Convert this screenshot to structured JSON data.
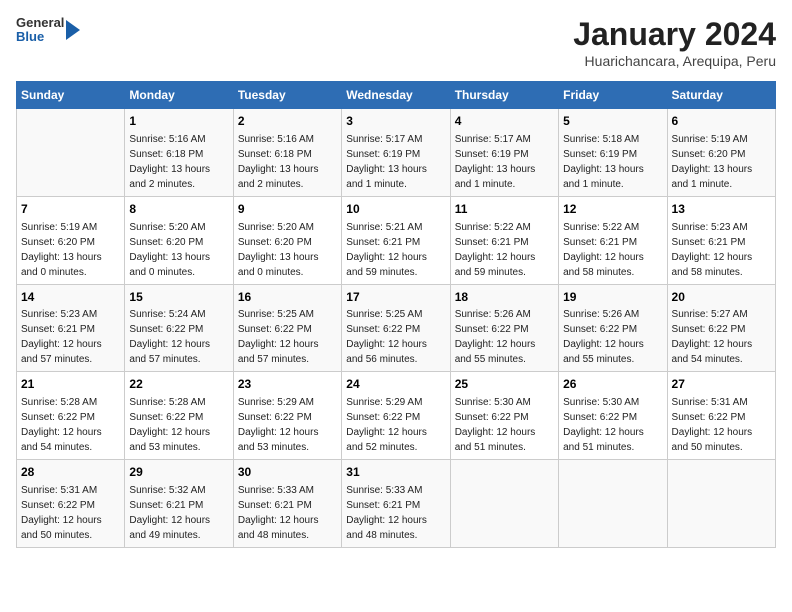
{
  "logo": {
    "general": "General",
    "blue": "Blue"
  },
  "title": "January 2024",
  "subtitle": "Huarichancara, Arequipa, Peru",
  "headers": [
    "Sunday",
    "Monday",
    "Tuesday",
    "Wednesday",
    "Thursday",
    "Friday",
    "Saturday"
  ],
  "weeks": [
    [
      {
        "day": "",
        "sunrise": "",
        "sunset": "",
        "daylight": ""
      },
      {
        "day": "1",
        "sunrise": "Sunrise: 5:16 AM",
        "sunset": "Sunset: 6:18 PM",
        "daylight": "Daylight: 13 hours and 2 minutes."
      },
      {
        "day": "2",
        "sunrise": "Sunrise: 5:16 AM",
        "sunset": "Sunset: 6:18 PM",
        "daylight": "Daylight: 13 hours and 2 minutes."
      },
      {
        "day": "3",
        "sunrise": "Sunrise: 5:17 AM",
        "sunset": "Sunset: 6:19 PM",
        "daylight": "Daylight: 13 hours and 1 minute."
      },
      {
        "day": "4",
        "sunrise": "Sunrise: 5:17 AM",
        "sunset": "Sunset: 6:19 PM",
        "daylight": "Daylight: 13 hours and 1 minute."
      },
      {
        "day": "5",
        "sunrise": "Sunrise: 5:18 AM",
        "sunset": "Sunset: 6:19 PM",
        "daylight": "Daylight: 13 hours and 1 minute."
      },
      {
        "day": "6",
        "sunrise": "Sunrise: 5:19 AM",
        "sunset": "Sunset: 6:20 PM",
        "daylight": "Daylight: 13 hours and 1 minute."
      }
    ],
    [
      {
        "day": "7",
        "sunrise": "Sunrise: 5:19 AM",
        "sunset": "Sunset: 6:20 PM",
        "daylight": "Daylight: 13 hours and 0 minutes."
      },
      {
        "day": "8",
        "sunrise": "Sunrise: 5:20 AM",
        "sunset": "Sunset: 6:20 PM",
        "daylight": "Daylight: 13 hours and 0 minutes."
      },
      {
        "day": "9",
        "sunrise": "Sunrise: 5:20 AM",
        "sunset": "Sunset: 6:20 PM",
        "daylight": "Daylight: 13 hours and 0 minutes."
      },
      {
        "day": "10",
        "sunrise": "Sunrise: 5:21 AM",
        "sunset": "Sunset: 6:21 PM",
        "daylight": "Daylight: 12 hours and 59 minutes."
      },
      {
        "day": "11",
        "sunrise": "Sunrise: 5:22 AM",
        "sunset": "Sunset: 6:21 PM",
        "daylight": "Daylight: 12 hours and 59 minutes."
      },
      {
        "day": "12",
        "sunrise": "Sunrise: 5:22 AM",
        "sunset": "Sunset: 6:21 PM",
        "daylight": "Daylight: 12 hours and 58 minutes."
      },
      {
        "day": "13",
        "sunrise": "Sunrise: 5:23 AM",
        "sunset": "Sunset: 6:21 PM",
        "daylight": "Daylight: 12 hours and 58 minutes."
      }
    ],
    [
      {
        "day": "14",
        "sunrise": "Sunrise: 5:23 AM",
        "sunset": "Sunset: 6:21 PM",
        "daylight": "Daylight: 12 hours and 57 minutes."
      },
      {
        "day": "15",
        "sunrise": "Sunrise: 5:24 AM",
        "sunset": "Sunset: 6:22 PM",
        "daylight": "Daylight: 12 hours and 57 minutes."
      },
      {
        "day": "16",
        "sunrise": "Sunrise: 5:25 AM",
        "sunset": "Sunset: 6:22 PM",
        "daylight": "Daylight: 12 hours and 57 minutes."
      },
      {
        "day": "17",
        "sunrise": "Sunrise: 5:25 AM",
        "sunset": "Sunset: 6:22 PM",
        "daylight": "Daylight: 12 hours and 56 minutes."
      },
      {
        "day": "18",
        "sunrise": "Sunrise: 5:26 AM",
        "sunset": "Sunset: 6:22 PM",
        "daylight": "Daylight: 12 hours and 55 minutes."
      },
      {
        "day": "19",
        "sunrise": "Sunrise: 5:26 AM",
        "sunset": "Sunset: 6:22 PM",
        "daylight": "Daylight: 12 hours and 55 minutes."
      },
      {
        "day": "20",
        "sunrise": "Sunrise: 5:27 AM",
        "sunset": "Sunset: 6:22 PM",
        "daylight": "Daylight: 12 hours and 54 minutes."
      }
    ],
    [
      {
        "day": "21",
        "sunrise": "Sunrise: 5:28 AM",
        "sunset": "Sunset: 6:22 PM",
        "daylight": "Daylight: 12 hours and 54 minutes."
      },
      {
        "day": "22",
        "sunrise": "Sunrise: 5:28 AM",
        "sunset": "Sunset: 6:22 PM",
        "daylight": "Daylight: 12 hours and 53 minutes."
      },
      {
        "day": "23",
        "sunrise": "Sunrise: 5:29 AM",
        "sunset": "Sunset: 6:22 PM",
        "daylight": "Daylight: 12 hours and 53 minutes."
      },
      {
        "day": "24",
        "sunrise": "Sunrise: 5:29 AM",
        "sunset": "Sunset: 6:22 PM",
        "daylight": "Daylight: 12 hours and 52 minutes."
      },
      {
        "day": "25",
        "sunrise": "Sunrise: 5:30 AM",
        "sunset": "Sunset: 6:22 PM",
        "daylight": "Daylight: 12 hours and 51 minutes."
      },
      {
        "day": "26",
        "sunrise": "Sunrise: 5:30 AM",
        "sunset": "Sunset: 6:22 PM",
        "daylight": "Daylight: 12 hours and 51 minutes."
      },
      {
        "day": "27",
        "sunrise": "Sunrise: 5:31 AM",
        "sunset": "Sunset: 6:22 PM",
        "daylight": "Daylight: 12 hours and 50 minutes."
      }
    ],
    [
      {
        "day": "28",
        "sunrise": "Sunrise: 5:31 AM",
        "sunset": "Sunset: 6:22 PM",
        "daylight": "Daylight: 12 hours and 50 minutes."
      },
      {
        "day": "29",
        "sunrise": "Sunrise: 5:32 AM",
        "sunset": "Sunset: 6:21 PM",
        "daylight": "Daylight: 12 hours and 49 minutes."
      },
      {
        "day": "30",
        "sunrise": "Sunrise: 5:33 AM",
        "sunset": "Sunset: 6:21 PM",
        "daylight": "Daylight: 12 hours and 48 minutes."
      },
      {
        "day": "31",
        "sunrise": "Sunrise: 5:33 AM",
        "sunset": "Sunset: 6:21 PM",
        "daylight": "Daylight: 12 hours and 48 minutes."
      },
      {
        "day": "",
        "sunrise": "",
        "sunset": "",
        "daylight": ""
      },
      {
        "day": "",
        "sunrise": "",
        "sunset": "",
        "daylight": ""
      },
      {
        "day": "",
        "sunrise": "",
        "sunset": "",
        "daylight": ""
      }
    ]
  ]
}
